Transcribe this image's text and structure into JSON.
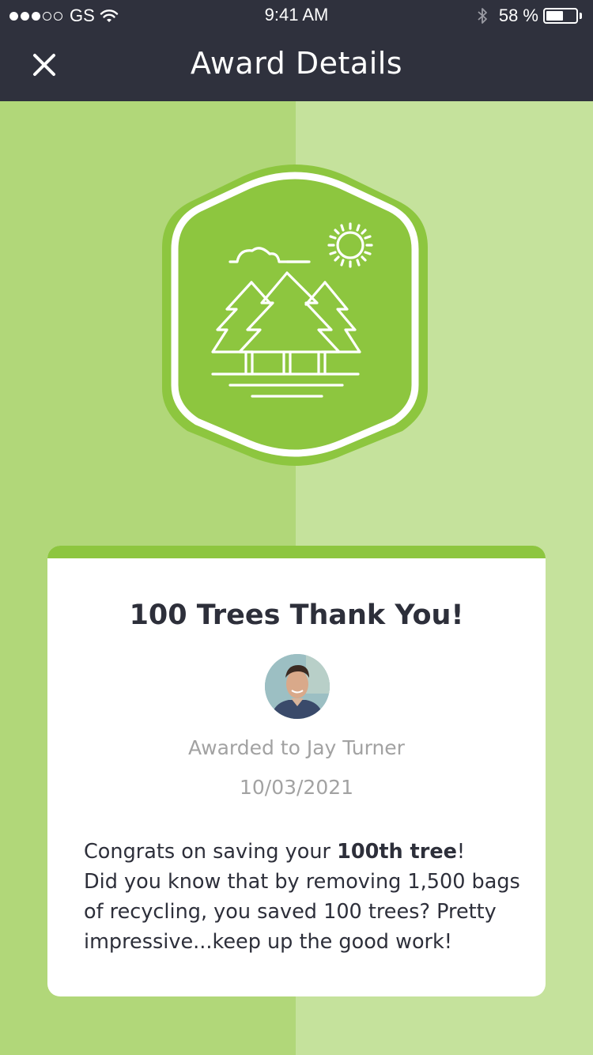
{
  "status_bar": {
    "carrier": "GS",
    "signal_bars_filled": 3,
    "signal_bars_total": 5,
    "time": "9:41 AM",
    "battery_percent": "58 %",
    "battery_level": 0.58,
    "icons": [
      "signal-dots-icon",
      "wifi-icon",
      "bluetooth-icon",
      "battery-icon"
    ]
  },
  "nav": {
    "title": "Award Details",
    "close_icon": "close-icon"
  },
  "badge": {
    "icon": "forest-trees-sun-icon",
    "fill_color": "#8dc63f"
  },
  "award": {
    "title": "100 Trees Thank You!",
    "awarded_to": "Awarded to Jay Turner",
    "date": "10/03/2021",
    "message_intro": "Congrats on saving your ",
    "message_bold": "100th tree",
    "message_end": "!",
    "message_body": "Did you know that by removing 1,500 bags of recycling, you saved 100 trees? Pretty impressive...keep up the good work!"
  },
  "colors": {
    "header": "#2f313d",
    "accent_green": "#8dc63f",
    "bg_left": "#b1d779",
    "bg_right": "#c5e29c",
    "text_dark": "#2d2f3a",
    "text_muted": "#a2a2a2"
  }
}
